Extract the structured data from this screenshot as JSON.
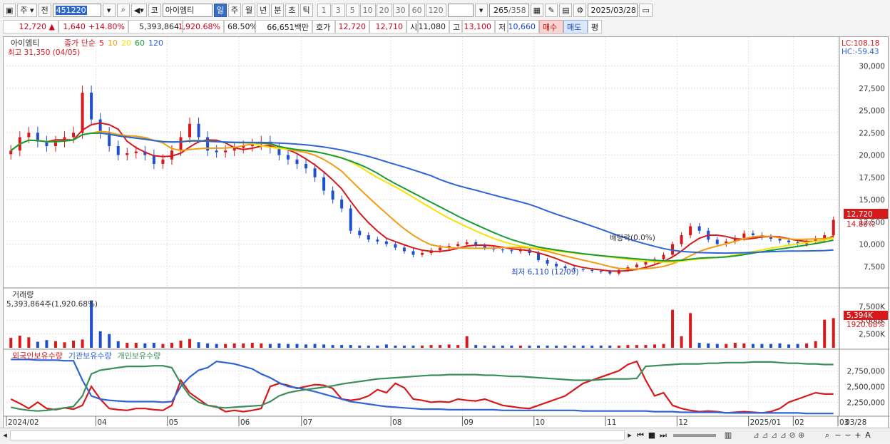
{
  "toolbar": {
    "period_main": "주",
    "jeon": "전",
    "code": "451220",
    "ko": "코",
    "stock_name": "아이엠티",
    "periods": [
      "일",
      "주",
      "월",
      "년",
      "분",
      "초",
      "틱"
    ],
    "active_period": "일",
    "nums": [
      "1",
      "3",
      "5",
      "10",
      "20",
      "30",
      "60",
      "120"
    ],
    "count": "265",
    "count_total": "/358",
    "date": "2025/03/28"
  },
  "quote": {
    "price": "12,720 ▲",
    "change": "1,640",
    "change_pct": "+14.80%",
    "volume": "5,393,864",
    "volume_pct": "1,920.68%",
    "rate": "68.50%",
    "amount": "66,651백만",
    "hoga_label": "호가",
    "ask": "12,720",
    "bid": "12,710",
    "open_label": "시",
    "open": "11,080",
    "high_label": "고",
    "high": "13,100",
    "low_label": "저",
    "low": "10,660",
    "buy": "매수",
    "sell": "매도",
    "eval": "평"
  },
  "colors": {
    "up": "#d7191c",
    "down": "#1f4fd1",
    "ma5": "#d7191c",
    "ma10": "#f39c12",
    "ma20": "#f4e400",
    "ma60": "#169b3a",
    "ma120": "#2f63d8",
    "foreign": "#d7191c",
    "institution": "#2f63d8",
    "individual": "#3a8f5a"
  },
  "chart_data": [
    {
      "type": "candlestick",
      "title": "아이엠티",
      "legend": [
        "종가 단순",
        "5",
        "10",
        "20",
        "60",
        "120"
      ],
      "y_ticks": [
        "30,000",
        "27,500",
        "25,000",
        "22,500",
        "20,000",
        "17,500",
        "15,000",
        "12,500",
        "10,000",
        "7,500"
      ],
      "ylim": [
        5400,
        31000
      ],
      "x_labels": [
        "2024/02",
        "04",
        "05",
        "06",
        "07",
        "08",
        "09",
        "10",
        "11",
        "12",
        "2025/01",
        "02",
        "03",
        "03/28"
      ],
      "annotations": {
        "high": "최고 31,350 (04/05)",
        "low": "최저 6,110 (12/09)",
        "dividend": "배당락(0.0%)",
        "lc": "LC:108.18",
        "hc": "HC:-59.43",
        "last_price": "12,720",
        "last_pct": "14.80%"
      },
      "close_series": [
        20500,
        22000,
        22500,
        21500,
        21000,
        21500,
        22000,
        22500,
        27000,
        24000,
        22500,
        21000,
        20000,
        20200,
        20400,
        20000,
        19000,
        19500,
        20500,
        22000,
        23500,
        22000,
        20500,
        20300,
        20500,
        20800,
        21000,
        21200,
        21500,
        20800,
        20000,
        19500,
        19000,
        18500,
        17500,
        16000,
        15000,
        14000,
        11500,
        11000,
        10500,
        10300,
        10000,
        9600,
        9200,
        8800,
        9000,
        9300,
        9600,
        9800,
        10000,
        10200,
        9800,
        9600,
        9400,
        9300,
        9200,
        9400,
        9000,
        8200,
        7800,
        7500,
        7300,
        7200,
        7100,
        7000,
        6900,
        6700,
        7100,
        7400,
        7700,
        8000,
        8300,
        8800,
        10000,
        11000,
        12000,
        11500,
        10500,
        10000,
        10300,
        10700,
        11200,
        11000,
        10800,
        10600,
        10400,
        10200,
        10000,
        10300,
        10600,
        11000,
        12720
      ]
    },
    {
      "type": "bar",
      "title": "거래량",
      "label": "5,393,864주(1,920.68%)",
      "y_ticks": [
        "7,500K",
        "5,000K",
        "2,500K"
      ],
      "ylim": [
        0,
        8800
      ],
      "unit": "K",
      "last_label": "5,394K",
      "last_pct": "1920.68%",
      "values": [
        1800,
        2200,
        1900,
        1100,
        1400,
        1200,
        1000,
        1300,
        1500,
        8600,
        3000,
        2500,
        1200,
        900,
        900,
        800,
        900,
        700,
        900,
        1300,
        1600,
        1000,
        800,
        700,
        700,
        800,
        800,
        900,
        800,
        700,
        800,
        700,
        700,
        600,
        700,
        600,
        500,
        500,
        500,
        400,
        400,
        400,
        600,
        400,
        400,
        400,
        400,
        500,
        500,
        600,
        500,
        2100,
        500,
        400,
        400,
        400,
        400,
        400,
        400,
        400,
        400,
        400,
        400,
        400,
        400,
        400,
        400,
        400,
        400,
        500,
        500,
        500,
        600,
        700,
        6900,
        2100,
        6300,
        900,
        800,
        700,
        700,
        900,
        800,
        700,
        700,
        700,
        800,
        600,
        700,
        800,
        1200,
        5100,
        5394
      ]
    },
    {
      "type": "line",
      "legend": [
        "외국인보유수량",
        "기관보유수량",
        "개인보유수량"
      ],
      "y_ticks": [
        "2,750,000",
        "2,500,000",
        "2,250,000"
      ],
      "ylim": [
        2050000,
        2980000
      ],
      "series": [
        {
          "name": "외국인보유수량",
          "values": [
            2300000,
            2230000,
            2150000,
            2250000,
            2150000,
            2130000,
            2160000,
            2140000,
            2200000,
            2500000,
            2300000,
            2150000,
            2130000,
            2120000,
            2150000,
            2150000,
            2130000,
            2120000,
            2200000,
            2600000,
            2400000,
            2300000,
            2200000,
            2180000,
            2100000,
            2120000,
            2100000,
            2120000,
            2150000,
            2500000,
            2550000,
            2520000,
            2470000,
            2500000,
            2530000,
            2520000,
            2470000,
            2300000,
            2280000,
            2300000,
            2350000,
            2450000,
            2400000,
            2550000,
            2480000,
            2300000,
            2280000,
            2250000,
            2260000,
            2250000,
            2300000,
            2280000,
            2270000,
            2300000,
            2250000,
            2200000,
            2180000,
            2160000,
            2150000,
            2200000,
            2250000,
            2300000,
            2350000,
            2450000,
            2550000,
            2600000,
            2650000,
            2700000,
            2750000,
            2850000,
            2900000,
            2600000,
            2350000,
            2400000,
            2200000,
            2150000,
            2120000,
            2100000,
            2110000,
            2100000,
            2080000,
            2090000,
            2100000,
            2090000,
            2080000,
            2100000,
            2150000,
            2250000,
            2300000,
            2350000,
            2400000,
            2380000,
            2380000
          ]
        },
        {
          "name": "기관보유수량",
          "values": [
            2930000,
            2930000,
            2930000,
            2920000,
            2920000,
            2920000,
            2910000,
            2910000,
            2600000,
            2350000,
            2300000,
            2280000,
            2270000,
            2260000,
            2260000,
            2260000,
            2260000,
            2250000,
            2260000,
            2500000,
            2650000,
            2760000,
            2800000,
            2900000,
            2880000,
            2860000,
            2820000,
            2780000,
            2700000,
            2640000,
            2560000,
            2500000,
            2480000,
            2450000,
            2420000,
            2380000,
            2340000,
            2300000,
            2260000,
            2240000,
            2220000,
            2200000,
            2180000,
            2170000,
            2160000,
            2150000,
            2140000,
            2140000,
            2140000,
            2130000,
            2130000,
            2130000,
            2130000,
            2130000,
            2130000,
            2120000,
            2120000,
            2120000,
            2120000,
            2120000,
            2120000,
            2120000,
            2120000,
            2120000,
            2110000,
            2110000,
            2110000,
            2110000,
            2110000,
            2110000,
            2110000,
            2110000,
            2100000,
            2100000,
            2100000,
            2090000,
            2090000,
            2090000,
            2090000,
            2090000,
            2080000,
            2080000,
            2080000,
            2080000,
            2080000,
            2080000,
            2080000,
            2080000,
            2080000,
            2070000,
            2070000,
            2070000,
            2070000
          ]
        },
        {
          "name": "개인보유수량",
          "values": [
            2170000,
            2140000,
            2120000,
            2110000,
            2120000,
            2140000,
            2160000,
            2180000,
            2350000,
            2700000,
            2760000,
            2780000,
            2800000,
            2820000,
            2820000,
            2820000,
            2830000,
            2830000,
            2800000,
            2550000,
            2350000,
            2250000,
            2200000,
            2170000,
            2160000,
            2170000,
            2180000,
            2190000,
            2200000,
            2260000,
            2350000,
            2400000,
            2430000,
            2450000,
            2470000,
            2490000,
            2510000,
            2540000,
            2560000,
            2580000,
            2600000,
            2620000,
            2630000,
            2640000,
            2650000,
            2660000,
            2670000,
            2680000,
            2680000,
            2690000,
            2690000,
            2690000,
            2690000,
            2680000,
            2680000,
            2670000,
            2660000,
            2660000,
            2650000,
            2640000,
            2630000,
            2620000,
            2610000,
            2600000,
            2600000,
            2600000,
            2610000,
            2620000,
            2620000,
            2620000,
            2630000,
            2820000,
            2830000,
            2840000,
            2850000,
            2860000,
            2860000,
            2860000,
            2870000,
            2870000,
            2880000,
            2880000,
            2880000,
            2890000,
            2890000,
            2890000,
            2880000,
            2870000,
            2870000,
            2860000,
            2860000,
            2850000,
            2850000
          ]
        }
      ]
    }
  ]
}
